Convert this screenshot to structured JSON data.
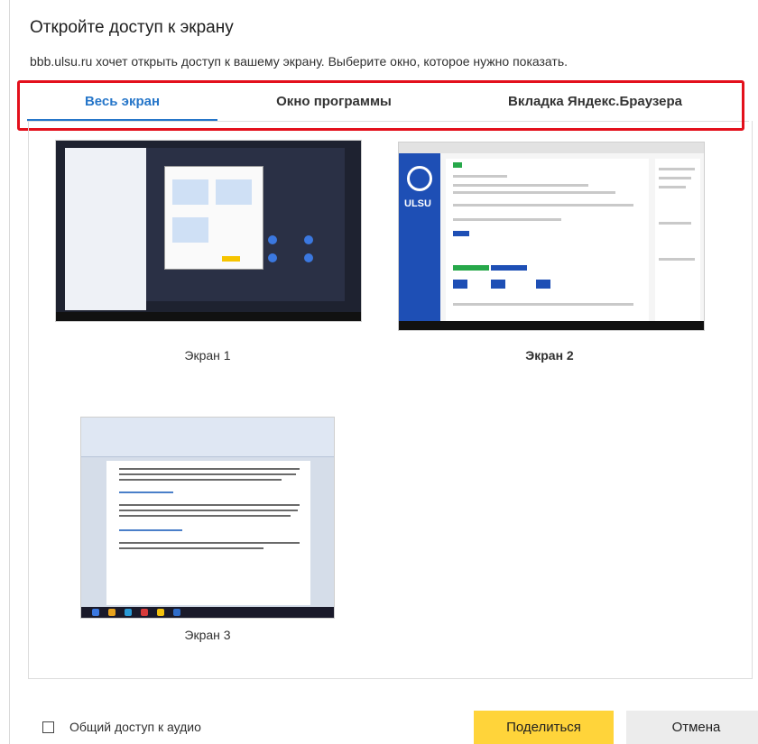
{
  "dialog": {
    "title": "Откройте доступ к экрану",
    "subtitle": "bbb.ulsu.ru хочет открыть доступ к вашему экрану. Выберите окно, которое нужно показать."
  },
  "tabs": [
    {
      "label": "Весь экран",
      "active": true
    },
    {
      "label": "Окно программы",
      "active": false
    },
    {
      "label": "Вкладка Яндекс.Браузера",
      "active": false
    }
  ],
  "screens": [
    {
      "label": "Экран 1",
      "selected": false
    },
    {
      "label": "Экран 2",
      "selected": true
    },
    {
      "label": "Экран 3",
      "selected": false
    }
  ],
  "thumbnail_text": {
    "screen2_logo": "ULSU"
  },
  "footer": {
    "audio_label": "Общий доступ к аудио",
    "audio_checked": false,
    "share_label": "Поделиться",
    "cancel_label": "Отмена"
  },
  "colors": {
    "accent": "#2676c9",
    "highlight": "#e3101c",
    "share_button": "#ffd43a"
  }
}
